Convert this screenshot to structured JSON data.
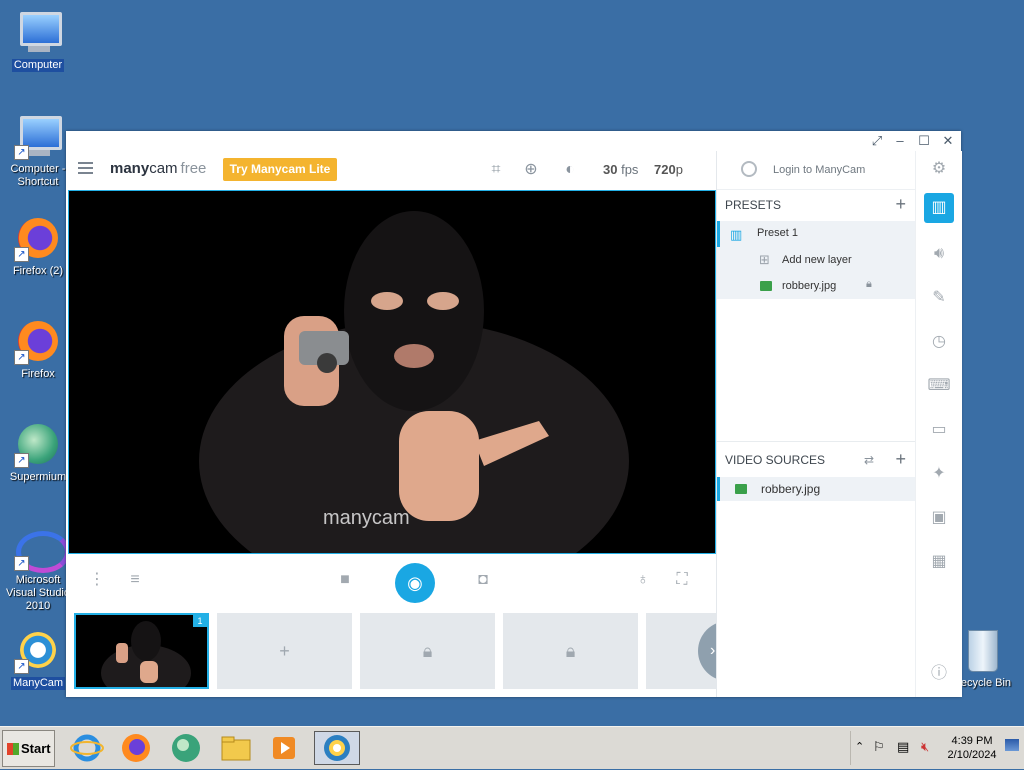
{
  "desktop": {
    "icons": [
      {
        "label": "Computer"
      },
      {
        "label": "Computer - Shortcut"
      },
      {
        "label": "Firefox (2)"
      },
      {
        "label": "Firefox"
      },
      {
        "label": "Supermium"
      },
      {
        "label": "Microsoft Visual Studio 2010"
      },
      {
        "label": "ManyCam"
      },
      {
        "label": "Recycle Bin"
      }
    ]
  },
  "window": {
    "controls": {
      "restore": "⤢",
      "minimize": "–",
      "maximize": "☐",
      "close": "✕"
    },
    "app": {
      "logo_bold": "many",
      "logo_rest": "cam",
      "logo_free": "free",
      "try_button": "Try Manycam Lite"
    },
    "toolbar": {
      "fps_value": "30",
      "fps_unit": "fps",
      "resolution_value": "720",
      "resolution_unit": "p"
    },
    "video": {
      "watermark": "manycam"
    },
    "thumbnails": {
      "badge": "1",
      "add": "+"
    }
  },
  "panel": {
    "login": "Login to ManyCam",
    "presets": {
      "header": "PRESETS",
      "items": [
        {
          "label": "Preset 1"
        },
        {
          "label": "Add new layer"
        },
        {
          "label": "robbery.jpg"
        }
      ]
    },
    "video_sources": {
      "header": "VIDEO SOURCES",
      "items": [
        {
          "label": "robbery.jpg"
        }
      ]
    }
  },
  "taskbar": {
    "start": "Start",
    "time": "4:39 PM",
    "date": "2/10/2024"
  },
  "colors": {
    "accent": "#1aa7e3",
    "try_button": "#f4b42f",
    "desktop": "#3a6ea5"
  }
}
